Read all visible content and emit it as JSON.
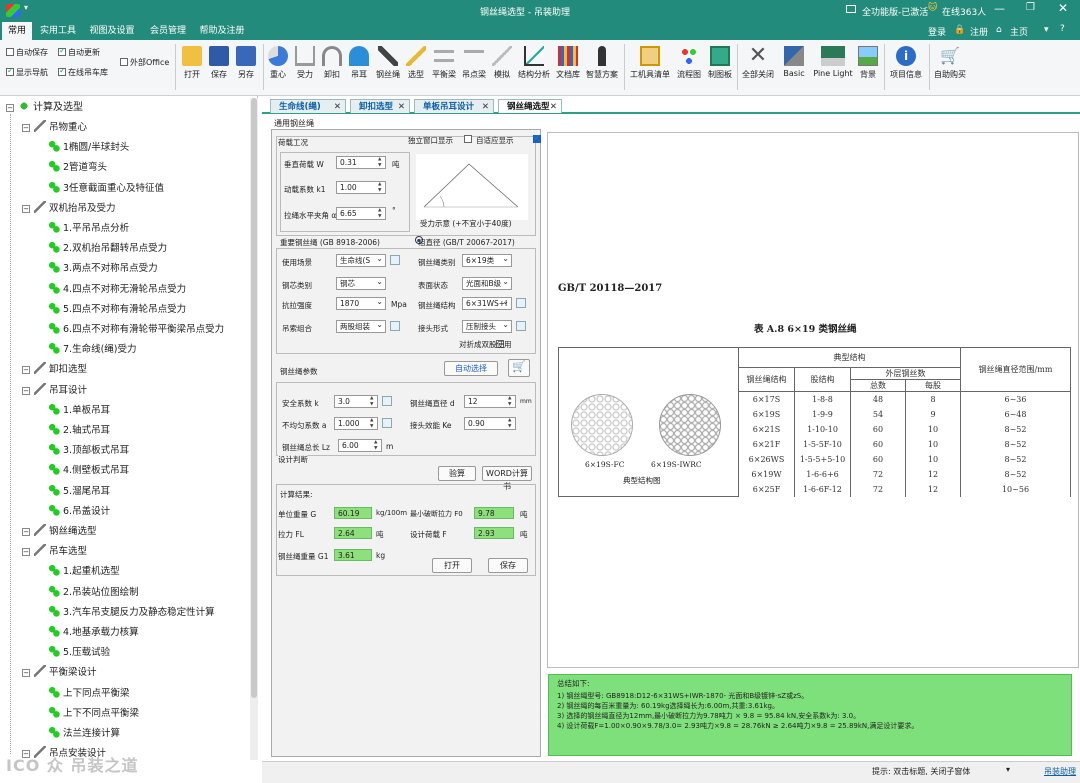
{
  "window": {
    "title": "钢丝绳选型 - 吊装助理",
    "status_right": "全功能版-已激活",
    "online": "在线363人",
    "login": "登录",
    "register": "注册",
    "home": "主页"
  },
  "menu": {
    "tabs": [
      "常用",
      "实用工具",
      "视图及设置",
      "会员管理",
      "帮助及注册"
    ],
    "active": "常用"
  },
  "ribbon": {
    "checks": [
      {
        "label": "自动保存",
        "on": false
      },
      {
        "label": "自动更新",
        "on": true
      },
      {
        "label": "显示导航",
        "on": true
      },
      {
        "label": "在线吊车库",
        "on": true
      },
      {
        "label": "外部Office",
        "on": false
      }
    ],
    "buttons": [
      "打开",
      "保存",
      "另存",
      "重心",
      "受力",
      "卸扣",
      "吊耳",
      "钢丝绳",
      "选型",
      "平衡梁",
      "吊点梁",
      "模拟",
      "结构分析",
      "文档库",
      "智慧方案",
      "工机具清单",
      "流程图",
      "制图板",
      "全部关闭",
      "Basic",
      "Pine Light",
      "背景",
      "项目信息",
      "自助购买"
    ]
  },
  "tree": {
    "root": "计算及选型",
    "items": [
      {
        "label": "吊物重心",
        "level": 1
      },
      {
        "label": "1椭圆/半球封头",
        "level": 2
      },
      {
        "label": "2管道弯头",
        "level": 2
      },
      {
        "label": "3任意截面重心及特征值",
        "level": 2
      },
      {
        "label": "双机抬吊及受力",
        "level": 1
      },
      {
        "label": "1.平吊吊点分析",
        "level": 2
      },
      {
        "label": "2.双机抬吊翻转吊点受力",
        "level": 2
      },
      {
        "label": "3.两点不对称吊点受力",
        "level": 2
      },
      {
        "label": "4.四点不对称无滑轮吊点受力",
        "level": 2
      },
      {
        "label": "5.四点不对称有滑轮吊点受力",
        "level": 2
      },
      {
        "label": "6.四点不对称有滑轮带平衡梁吊点受力",
        "level": 2
      },
      {
        "label": "7.生命线(绳)受力",
        "level": 2
      },
      {
        "label": "卸扣选型",
        "level": 1
      },
      {
        "label": "吊耳设计",
        "level": 1
      },
      {
        "label": "1.单板吊耳",
        "level": 2
      },
      {
        "label": "2.轴式吊耳",
        "level": 2
      },
      {
        "label": "3.顶部板式吊耳",
        "level": 2
      },
      {
        "label": "4.侧壁板式吊耳",
        "level": 2
      },
      {
        "label": "5.溜尾吊耳",
        "level": 2
      },
      {
        "label": "6.吊盖设计",
        "level": 2
      },
      {
        "label": "钢丝绳选型",
        "level": 1
      },
      {
        "label": "吊车选型",
        "level": 1
      },
      {
        "label": "1.起重机选型",
        "level": 2
      },
      {
        "label": "2.吊装站位图绘制",
        "level": 2
      },
      {
        "label": "3.汽车吊支腿反力及静态稳定性计算",
        "level": 2
      },
      {
        "label": "4.地基承载力核算",
        "level": 2
      },
      {
        "label": "5.压载试验",
        "level": 2
      },
      {
        "label": "平衡梁设计",
        "level": 1
      },
      {
        "label": "上下同点平衡梁",
        "level": 2
      },
      {
        "label": "上下不同点平衡梁",
        "level": 2
      },
      {
        "label": "法兰连接计算",
        "level": 2
      },
      {
        "label": "吊点安装设计",
        "level": 1
      }
    ]
  },
  "doc_tabs": [
    {
      "label": "生命线(绳)",
      "active": false
    },
    {
      "label": "卸扣选型",
      "active": false
    },
    {
      "label": "单板吊耳设计",
      "active": false
    },
    {
      "label": "钢丝绳选型",
      "active": true
    }
  ],
  "panel": {
    "header": "通用钢丝绳",
    "load_group": "荷载工况",
    "independent_window": "独立窗口显示",
    "auto_display": "自适应显示",
    "vertical_load_label": "垂直荷载 W",
    "vertical_load": "0.31",
    "vertical_load_unit": "吨",
    "dynamic_label": "动载系数 k1",
    "dynamic": "1.00",
    "angle_label": "拉绳水平夹角 α",
    "angle": "6.65",
    "angle_unit": "°",
    "diagram_caption": "受力示意 (+不宜小于40度)",
    "std_heavy": "重要钢丝绳 (GB 8918-2006)",
    "std_coarse": "粗直径 (GB/T 20067-2017)",
    "scene_label": "使用场景",
    "scene": "生命线(S",
    "rope_cat_label": "钢丝绳类别",
    "rope_cat": "6×19类",
    "core_label": "钢芯类别",
    "core": "钢芯",
    "surface_label": "表面状态",
    "surface": "光面和B级",
    "tensile_label": "抗拉强度",
    "tensile": "1870",
    "tensile_unit": "Mpa",
    "structure_label": "钢丝绳结构",
    "structure": "6×31WS+I",
    "combo_label": "吊索组合",
    "combo": "两股组装",
    "joint_label": "接头形式",
    "joint": "压制接头",
    "fold_label": "对折成双股使用",
    "params_label": "钢丝绳参数",
    "auto_select": "自动选择",
    "safety_label": "安全系数 k",
    "safety": "3.0",
    "diameter_label": "钢丝绳直径 d",
    "diameter": "12",
    "diameter_unit": "mm",
    "uneven_label": "不均匀系数 a",
    "uneven": "1.000",
    "joint_eff_label": "接头效能 Ke",
    "joint_eff": "0.90",
    "length_label": "钢丝绳总长 Lz",
    "length": "6.00",
    "length_unit": "m",
    "judge_label": "设计判断",
    "calc_btn": "验算",
    "word_btn": "WORD计算书",
    "result_label": "计算结果:",
    "unit_weight_label": "单位重量 G",
    "unit_weight": "60.19",
    "unit_weight_unit": "kg/100m",
    "min_break_label": "最小破断拉力 F0",
    "min_break": "9.78",
    "min_break_unit": "吨",
    "pull_label": "拉力 FL",
    "pull": "2.64",
    "pull_unit": "吨",
    "design_load_label": "设计荷载 F",
    "design_load": "2.93",
    "design_load_unit": "吨",
    "rope_weight_label": "钢丝绳重量 G1",
    "rope_weight": "3.61",
    "rope_weight_unit": "kg",
    "open_btn": "打开",
    "save_btn": "保存"
  },
  "doc": {
    "std_no": "GB/T 20118—2017",
    "table_title": "表 A.8   6×19 类钢丝绳",
    "col_typical": "典型结构",
    "col_rope": "钢丝绳结构",
    "col_strand": "股结构",
    "col_outer": "外层钢丝数",
    "col_total": "总数",
    "col_per": "每股",
    "col_range": "钢丝绳直径范围/mm",
    "img1": "6×19S-FC",
    "img2": "6×19S-IWRC",
    "img_caption": "典型结构图",
    "rows": [
      [
        "6×17S",
        "1-8-8",
        "48",
        "8",
        "6~36"
      ],
      [
        "6×19S",
        "1-9-9",
        "54",
        "9",
        "6~48"
      ],
      [
        "6×21S",
        "1-10-10",
        "60",
        "10",
        "8~52"
      ],
      [
        "6×21F",
        "1-5-5F-10",
        "60",
        "10",
        "8~52"
      ],
      [
        "6×26WS",
        "1-5-5+5-10",
        "60",
        "10",
        "8~52"
      ],
      [
        "6×19W",
        "1-6-6+6",
        "72",
        "12",
        "8~52"
      ],
      [
        "6×25F",
        "1-6-6F-12",
        "72",
        "12",
        "10~56"
      ]
    ]
  },
  "summary": {
    "title": "总结如下:",
    "lines": [
      "1) 钢丝绳型号: GB8918:D12-6×31WS+IWR-1870- 光面和B级镀锌-sZ或zS。",
      "2) 钢丝绳的每百米重量为: 60.19kg选择绳长为:6.00m,共重:3.61kg。",
      "3) 选择的钢丝绳直径为12mm,最小破断拉力为9.78吨力 × 9.8 = 95.84 kN,安全系数k为: 3.0。",
      "4) 设计荷载F=1.00×0.90×9.78/3.0= 2.93吨力×9.8 = 28.76kN ≥ 2.64吨力×9.8 = 25.89kN,满足设计要求。"
    ]
  },
  "statusbar": {
    "hint": "提示: 双击标题, 关闭子窗体",
    "link": "吊装助理"
  },
  "colors": {
    "brand": "#238b7b",
    "result": "#8ee07a",
    "summary": "#7ee07a",
    "link": "#0b5ea8"
  }
}
